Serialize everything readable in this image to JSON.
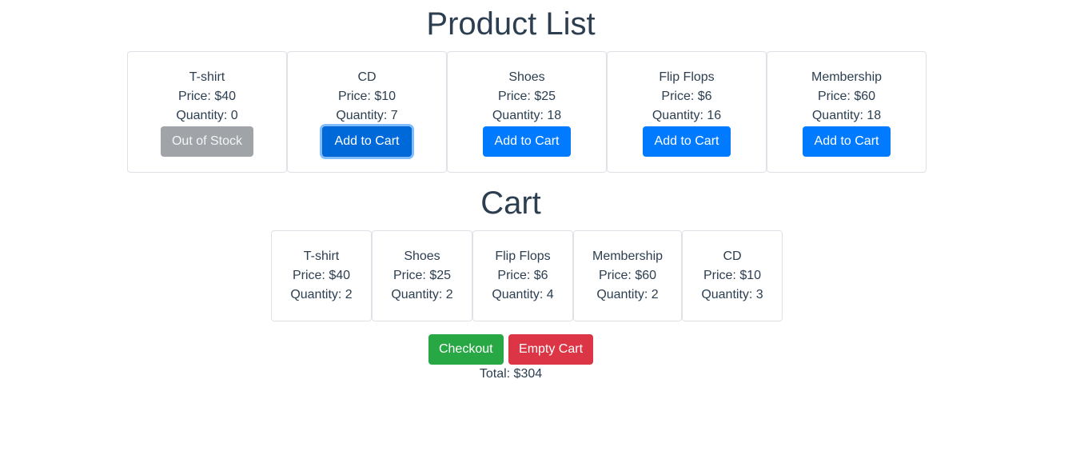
{
  "product_list": {
    "title": "Product List",
    "items": [
      {
        "name": "T-shirt",
        "price": "Price: $40",
        "quantity": "Quantity: 0",
        "button": "Out of Stock"
      },
      {
        "name": "CD",
        "price": "Price: $10",
        "quantity": "Quantity: 7",
        "button": "Add to Cart"
      },
      {
        "name": "Shoes",
        "price": "Price: $25",
        "quantity": "Quantity: 18",
        "button": "Add to Cart"
      },
      {
        "name": "Flip Flops",
        "price": "Price: $6",
        "quantity": "Quantity: 16",
        "button": "Add to Cart"
      },
      {
        "name": "Membership",
        "price": "Price: $60",
        "quantity": "Quantity: 18",
        "button": "Add to Cart"
      }
    ]
  },
  "cart": {
    "title": "Cart",
    "items": [
      {
        "name": "T-shirt",
        "price": "Price: $40",
        "quantity": "Quantity: 2"
      },
      {
        "name": "Shoes",
        "price": "Price: $25",
        "quantity": "Quantity: 2"
      },
      {
        "name": "Flip Flops",
        "price": "Price: $6",
        "quantity": "Quantity: 4"
      },
      {
        "name": "Membership",
        "price": "Price: $60",
        "quantity": "Quantity: 2"
      },
      {
        "name": "CD",
        "price": "Price: $10",
        "quantity": "Quantity: 3"
      }
    ],
    "checkout_label": "Checkout",
    "empty_label": "Empty Cart",
    "total": "Total: $304"
  },
  "colors": {
    "primary": "#007bff",
    "secondary": "#a0a4a8",
    "success": "#28a745",
    "danger": "#dc3545",
    "text": "#2c3e50",
    "border": "#dee2e6"
  }
}
